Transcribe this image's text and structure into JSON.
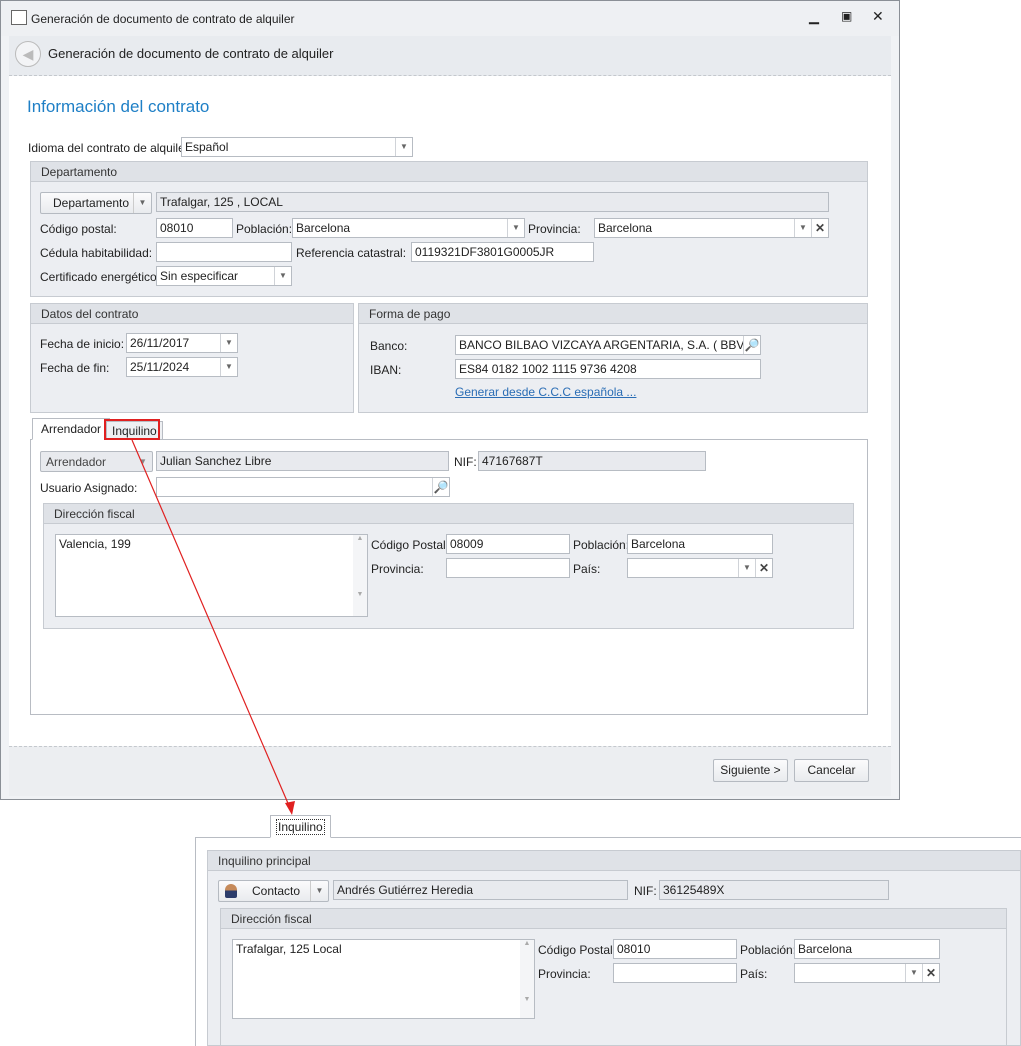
{
  "window": {
    "title": "Generación de documento de contrato de alquiler",
    "header": "Generación de documento de contrato de alquiler",
    "page_title": "Información del contrato"
  },
  "idioma": {
    "label": "Idioma del contrato de alquiler:",
    "value": "Español"
  },
  "departamento": {
    "group": "Departamento",
    "button": "Departamento",
    "address": "Trafalgar, 125 , LOCAL",
    "cp_label": "Código postal:",
    "cp": "08010",
    "poblacion_label": "Población:",
    "poblacion": "Barcelona",
    "provincia_label": "Provincia:",
    "provincia": "Barcelona",
    "cedula_label": "Cédula habitabilidad:",
    "cedula": "",
    "ref_label": "Referencia catastral:",
    "ref": "0119321DF3801G0005JR",
    "cert_label": "Certificado energético:",
    "cert": "Sin especificar"
  },
  "contrato": {
    "group": "Datos del contrato",
    "inicio_label": "Fecha de inicio:",
    "inicio": "26/11/2017",
    "fin_label": "Fecha de fin:",
    "fin": "25/11/2024"
  },
  "pago": {
    "group": "Forma de pago",
    "banco_label": "Banco:",
    "banco": "BANCO BILBAO VIZCAYA ARGENTARIA, S.A. ( BBVAESMM",
    "iban_label": "IBAN:",
    "iban": "ES84 0182 1002 1115 9736 4208",
    "link": "Generar desde C.C.C española ..."
  },
  "tabs": [
    "Arrendador",
    "Inquilino"
  ],
  "arrendador": {
    "button": "Arrendador",
    "name": "Julian Sanchez Libre",
    "nif_label": "NIF:",
    "nif": "47167687T",
    "usuario_label": "Usuario Asignado:",
    "usuario": "",
    "dir_group": "Dirección fiscal",
    "direccion": "Valencia, 199",
    "cp_label": "Código Postal:",
    "cp": "08009",
    "poblacion_label": "Población:",
    "poblacion": "Barcelona",
    "provincia_label": "Provincia:",
    "provincia": "",
    "pais_label": "País:",
    "pais": ""
  },
  "buttons": {
    "next": "Siguiente >",
    "cancel": "Cancelar"
  },
  "inquilino": {
    "tab": "Inquilino",
    "group": "Inquilino principal",
    "button": "Contacto",
    "name": "Andrés Gutiérrez Heredia",
    "nif_label": "NIF:",
    "nif": "36125489X",
    "dir_group": "Dirección fiscal",
    "direccion": "Trafalgar, 125 Local",
    "cp_label": "Código Postal:",
    "cp": "08010",
    "poblacion_label": "Población:",
    "poblacion": "Barcelona",
    "provincia_label": "Provincia:",
    "provincia": "",
    "pais_label": "País:",
    "pais": ""
  },
  "colors": {
    "accent": "#1e7fc6",
    "annotation": "#e02020",
    "link": "#2a6db5"
  }
}
